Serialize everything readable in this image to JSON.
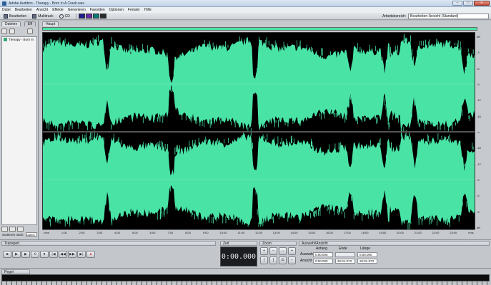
{
  "window": {
    "title": "Adobe Audition - Therapy - Born In A Crash.wav",
    "controls": {
      "minimize": "–",
      "maximize": "□",
      "close": "✕"
    }
  },
  "menu": [
    "Datei",
    "Bearbeiten",
    "Ansicht",
    "Effekte",
    "Generieren",
    "Favoriten",
    "Optionen",
    "Fenster",
    "Hilfe"
  ],
  "toolbar": {
    "edit_label": "Bearbeiten",
    "multitrack_label": "Multitrack",
    "cd_label": "CD",
    "mode_colors": [
      "#1f1f8a",
      "#6a2aa6",
      "#0b7a76",
      "#2a2a2a"
    ],
    "workspace_label": "Arbeitsbereich:",
    "workspace_value": "Bearbeiten-Ansicht (Standard)"
  },
  "files_panel": {
    "tab_files": "Dateien",
    "tab_effects": "Eff",
    "items": [
      {
        "label": "Therapy - Born In",
        "icon": "wave-file-icon"
      }
    ],
    "sort_label": "Sortieren nach:",
    "sort_value": "Datein"
  },
  "editor": {
    "tab_label": "Haupt",
    "wave_color": "#49e3a6",
    "scale_labels": [
      "dB",
      "-3",
      "-6",
      "-9",
      "-12",
      "-18",
      "-∞",
      "-18",
      "-12",
      "-9",
      "-6",
      "-3",
      "dB"
    ],
    "timeline_labels": [
      "hms",
      "1:00",
      "2:00",
      "3:00",
      "4:00",
      "5:00",
      "6:00",
      "7:00",
      "8:00",
      "9:00",
      "10:00",
      "11:00",
      "12:00",
      "13:00",
      "14:00",
      "15:00",
      "16:00",
      "17:00",
      "18:00",
      "19:00",
      "20:00",
      "21:00",
      "22:00",
      "23:00",
      "hms"
    ]
  },
  "transport": {
    "title": "Transport",
    "buttons": [
      "■",
      "▶",
      "▶",
      "⟲",
      "⏺",
      "|◀",
      "◀◀",
      "▶▶",
      "▶|",
      "●"
    ]
  },
  "time": {
    "title": "Zeit",
    "value": "0:00.000"
  },
  "zoom": {
    "title": "Zoom"
  },
  "selection": {
    "title": "Auswahl/Ansicht",
    "col_start": "Anfang",
    "col_end": "Ende",
    "col_length": "Länge",
    "row_selection": "Auswahl",
    "row_view": "Ansicht",
    "sel_start": "0:00.000",
    "sel_end": "",
    "sel_length": "0:00.000",
    "view_start": "0:00.000",
    "view_end": "26:01.973",
    "view_length": "26:01.973"
  },
  "level": {
    "title": "Pegel"
  }
}
